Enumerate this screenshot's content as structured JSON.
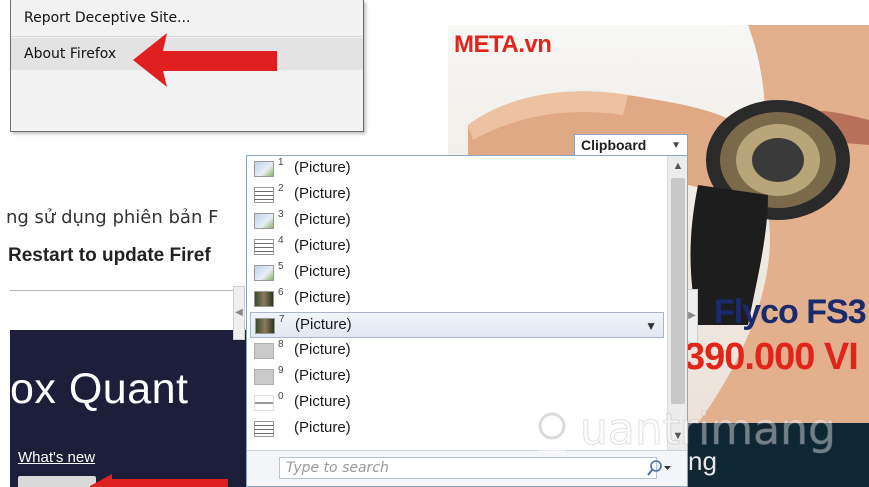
{
  "help_menu": {
    "items": [
      {
        "label": "Report Deceptive Site..."
      },
      {
        "label": "About Firefox"
      }
    ]
  },
  "page": {
    "line1": "ng sử dụng phiên bản F",
    "line2": "Restart to update Firef"
  },
  "banner": {
    "heading": "ox Quant",
    "link": "What's new"
  },
  "ad": {
    "logo": "META.vn",
    "product": "Flyco FS3",
    "price": "390.000 VI",
    "bottom_text": "ng"
  },
  "clipboard": {
    "title": "Clipboard",
    "items": [
      {
        "num": "1",
        "label": "(Picture)",
        "thumb": "pic"
      },
      {
        "num": "2",
        "label": "(Picture)",
        "thumb": "doc"
      },
      {
        "num": "3",
        "label": "(Picture)",
        "thumb": "pic"
      },
      {
        "num": "4",
        "label": "(Picture)",
        "thumb": "doc"
      },
      {
        "num": "5",
        "label": "(Picture)",
        "thumb": "pic"
      },
      {
        "num": "6",
        "label": "(Picture)",
        "thumb": "photo"
      },
      {
        "num": "7",
        "label": "(Picture)",
        "thumb": "photo",
        "selected": true
      },
      {
        "num": "8",
        "label": "(Picture)",
        "thumb": "grey"
      },
      {
        "num": "9",
        "label": "(Picture)",
        "thumb": "grey"
      },
      {
        "num": "0",
        "label": "(Picture)",
        "thumb": "line"
      },
      {
        "num": "",
        "label": "(Picture)",
        "thumb": "doc"
      }
    ],
    "search_placeholder": "Type to search"
  },
  "watermark": "Quantrimang",
  "colors": {
    "arrow_red": "#e02020",
    "banner_dark": "#1d1f3a",
    "ad_red": "#e1251b",
    "ad_blue": "#1b2a6b",
    "gallery_border": "#8aa6c7"
  }
}
